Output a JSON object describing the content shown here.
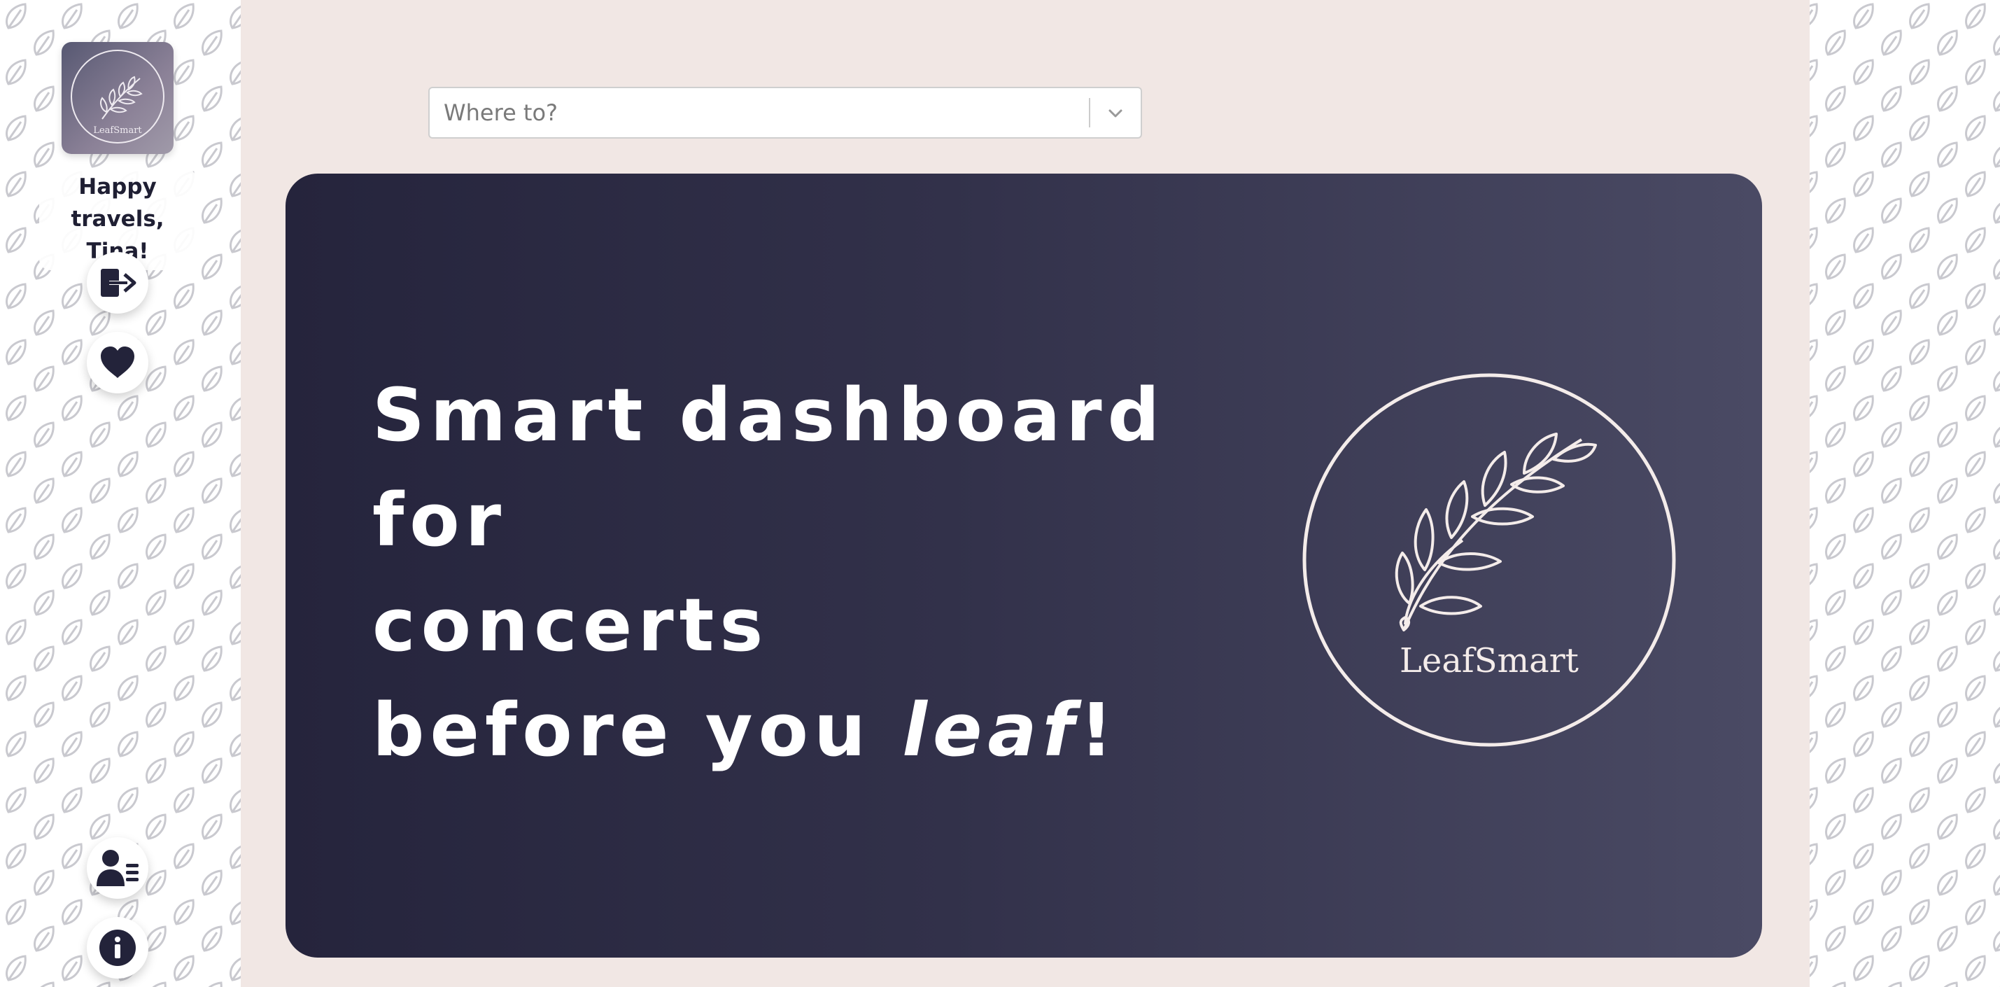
{
  "sidebar": {
    "logo_text": "LeafSmart",
    "greeting_line1": "Happy",
    "greeting_line2": "travels, Tina!",
    "buttons": [
      {
        "id": "logout",
        "icon": "logout-icon"
      },
      {
        "id": "favorites",
        "icon": "heart-icon"
      },
      {
        "id": "profile",
        "icon": "user-list-icon"
      },
      {
        "id": "info",
        "icon": "info-icon"
      }
    ]
  },
  "search": {
    "placeholder": "Where to?",
    "dropdown_icon": "chevron-down-icon"
  },
  "hero": {
    "line1": "Smart dashboard",
    "line2": "for",
    "line3": "concerts",
    "line4_prefix": "before you ",
    "line4_emphasis": "leaf",
    "line4_suffix": "!",
    "emblem_text": "LeafSmart"
  },
  "colors": {
    "page_background": "#f1e7e4",
    "hero_gradient_start": "#25243c",
    "hero_gradient_end": "#4a4a64",
    "accent_dark": "#1f1f33",
    "pattern_stroke": "#c9c9cf"
  }
}
